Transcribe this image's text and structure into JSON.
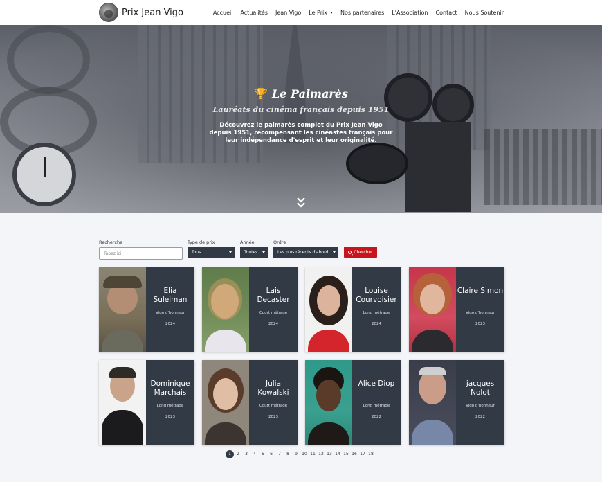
{
  "brand": {
    "name": "Prix Jean Vigo"
  },
  "nav": [
    "Accueil",
    "Actualités",
    "Jean Vigo",
    "Le Prix",
    "Nos partenaires",
    "L'Association",
    "Contact",
    "Nous Soutenir"
  ],
  "hero": {
    "title": "Le Palmarès",
    "subtitle": "Lauréats du cinéma français depuis 1951",
    "description": "Découvrez le palmarès complet du Prix Jean Vigo depuis 1951, récompensant les cinéastes français pour leur indépendance d'esprit et leur originalité."
  },
  "filters": {
    "search_label": "Recherche",
    "search_placeholder": "Tapez ici",
    "type_label": "Type de prix",
    "type_value": "Tous",
    "year_label": "Année",
    "year_value": "Toutes",
    "order_label": "Ordre",
    "order_value": "Les plus récents d'abord",
    "search_button": "Chercher"
  },
  "cards": [
    {
      "name": "Elia Suleiman",
      "category": "Vigo d'honneur",
      "year": "2024"
    },
    {
      "name": "Lais Decaster",
      "category": "Court métrage",
      "year": "2024"
    },
    {
      "name": "Louise Courvoisier",
      "category": "Long métrage",
      "year": "2024"
    },
    {
      "name": "Claire Simon",
      "category": "Vigo d'honneur",
      "year": "2023"
    },
    {
      "name": "Dominique Marchais",
      "category": "Long métrage",
      "year": "2023"
    },
    {
      "name": "Julia Kowalski",
      "category": "Court métrage",
      "year": "2023"
    },
    {
      "name": "Alice Diop",
      "category": "Long métrage",
      "year": "2022"
    },
    {
      "name": "jacques Nolot",
      "category": "Vigo d'honneur",
      "year": "2022"
    }
  ],
  "pagination": {
    "current": "1",
    "pages": [
      "1",
      "2",
      "3",
      "4",
      "5",
      "6",
      "7",
      "8",
      "9",
      "10",
      "11",
      "12",
      "13",
      "14",
      "15",
      "16",
      "17",
      "18"
    ]
  },
  "colors": {
    "card_bg": "#323a46",
    "accent": "#c8141c",
    "nav_bg": "#ffffff"
  }
}
